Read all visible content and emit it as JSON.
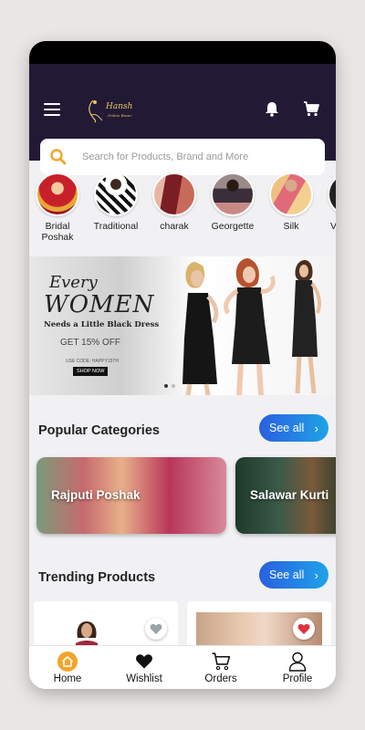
{
  "header": {
    "logo_text": "Hansh",
    "logo_sub": "Online Bazar"
  },
  "search": {
    "placeholder": "Search for Products, Brand and More"
  },
  "categories": [
    {
      "label": "Bridal Poshak"
    },
    {
      "label": "Traditional"
    },
    {
      "label": "charak"
    },
    {
      "label": "Georgette"
    },
    {
      "label": "Silk"
    },
    {
      "label": "V"
    }
  ],
  "banner": {
    "line1": "Every",
    "line2": "WOMEN",
    "line3": "Needs a Little Black Dress",
    "offer": "GET 15% OFF",
    "code": "USE CODE: HAPPY15TH",
    "cta": "SHOP NOW"
  },
  "popular": {
    "title": "Popular Categories",
    "see_all": "See all",
    "cards": [
      {
        "label": "Rajputi Poshak"
      },
      {
        "label": "Salawar Kurti"
      }
    ]
  },
  "trending": {
    "title": "Trending Products",
    "see_all": "See all"
  },
  "nav": [
    {
      "label": "Home",
      "icon": "home-icon"
    },
    {
      "label": "Wishlist",
      "icon": "heart-icon"
    },
    {
      "label": "Orders",
      "icon": "cart-icon"
    },
    {
      "label": "Profile",
      "icon": "person-icon"
    }
  ],
  "colors": {
    "accent": "#f2a52a",
    "appbar": "#221a35",
    "button_from": "#2a5fe0",
    "button_to": "#1fa3e8",
    "wishlist_active": "#e0313e"
  }
}
